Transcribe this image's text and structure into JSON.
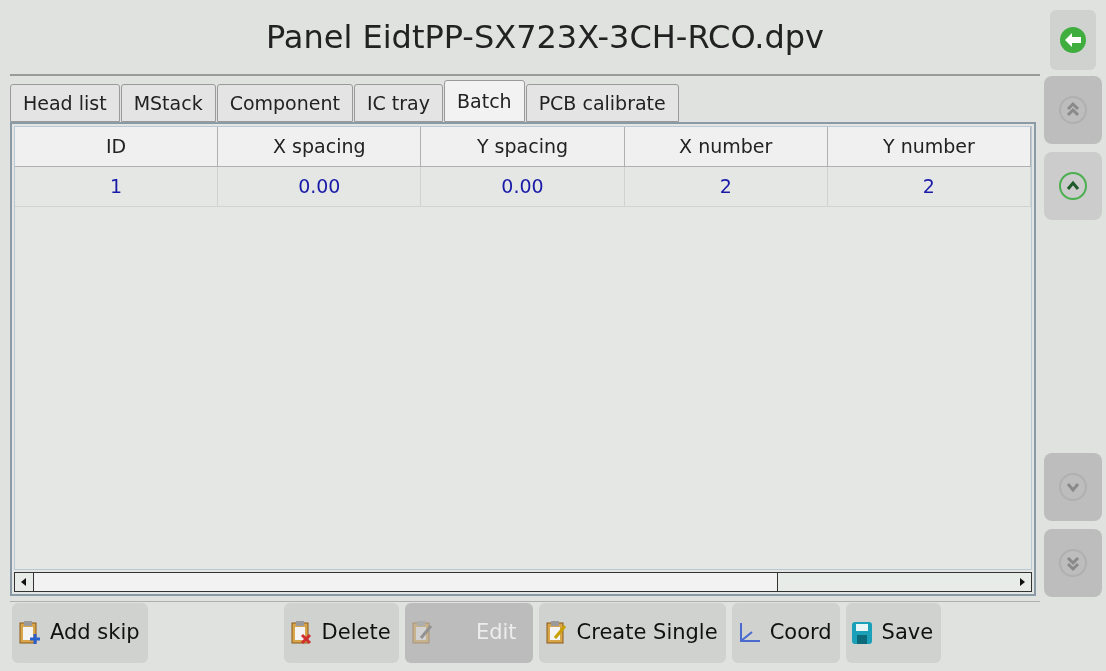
{
  "window": {
    "title": "Panel EidtPP-SX723X-3CH-RCO.dpv"
  },
  "back_button": {
    "disabled": false
  },
  "tabs": [
    {
      "label": "Head list",
      "selected": false
    },
    {
      "label": "MStack",
      "selected": false
    },
    {
      "label": "Component",
      "selected": false
    },
    {
      "label": "IC tray",
      "selected": false
    },
    {
      "label": "Batch",
      "selected": true
    },
    {
      "label": "PCB calibrate",
      "selected": false
    }
  ],
  "table": {
    "columns": [
      "ID",
      "X spacing",
      "Y spacing",
      "X number",
      "Y number"
    ],
    "rows": [
      [
        "1",
        "0.00",
        "0.00",
        "2",
        "2"
      ]
    ]
  },
  "side_buttons": [
    {
      "kind": "top",
      "disabled": true
    },
    {
      "kind": "up",
      "disabled": false
    },
    {
      "kind": "down",
      "disabled": true
    },
    {
      "kind": "bottom",
      "disabled": true
    }
  ],
  "toolbar": [
    {
      "kind": "add",
      "label": "Add skip",
      "disabled": false
    },
    {
      "kind": "delete",
      "label": "Delete",
      "disabled": false
    },
    {
      "kind": "edit",
      "label": "Edit",
      "disabled": true
    },
    {
      "kind": "create",
      "label": "Create Single",
      "disabled": false
    },
    {
      "kind": "coord",
      "label": "Coord",
      "disabled": false
    },
    {
      "kind": "save",
      "label": "Save",
      "disabled": false
    }
  ]
}
